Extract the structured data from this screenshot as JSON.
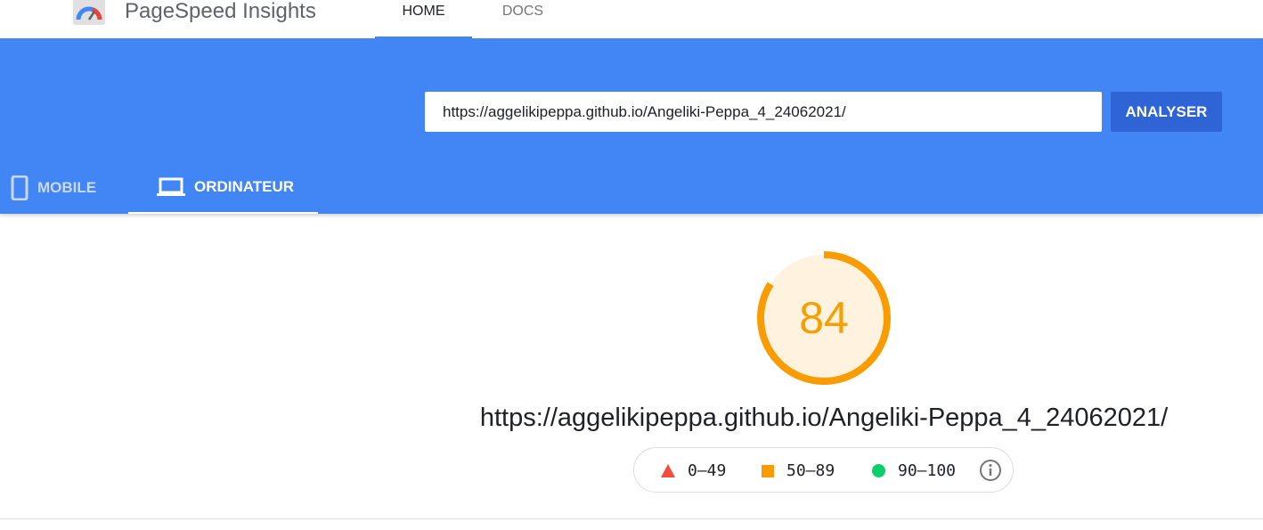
{
  "app": {
    "title": "PageSpeed Insights",
    "logo_icon": "pagespeed-gauge-logo"
  },
  "nav": {
    "tabs": [
      {
        "label": "HOME",
        "active": true
      },
      {
        "label": "DOCS",
        "active": false
      }
    ]
  },
  "search": {
    "value": "https://aggelikipeppa.github.io/Angeliki-Peppa_4_24062021/",
    "button_label": "ANALYSER"
  },
  "device_tabs": [
    {
      "label": "MOBILE",
      "icon": "smartphone-icon",
      "active": false
    },
    {
      "label": "ORDINATEUR",
      "icon": "laptop-icon",
      "active": true
    }
  ],
  "report": {
    "score": "84",
    "score_fraction": 0.84,
    "url": "https://aggelikipeppa.github.io/Angeliki-Peppa_4_24062021/"
  },
  "legend": [
    {
      "range": "0–49",
      "icon": "triangle-icon",
      "color": "#f14c3d"
    },
    {
      "range": "50–89",
      "icon": "square-icon",
      "color": "#fa9c00"
    },
    {
      "range": "90–100",
      "icon": "circle-icon",
      "color": "#0cce6b"
    }
  ],
  "colors": {
    "header_blue": "#4285f4",
    "button_blue": "#2f64d6",
    "score_orange": "#fa9c00",
    "score_fill": "#fff3e0"
  }
}
